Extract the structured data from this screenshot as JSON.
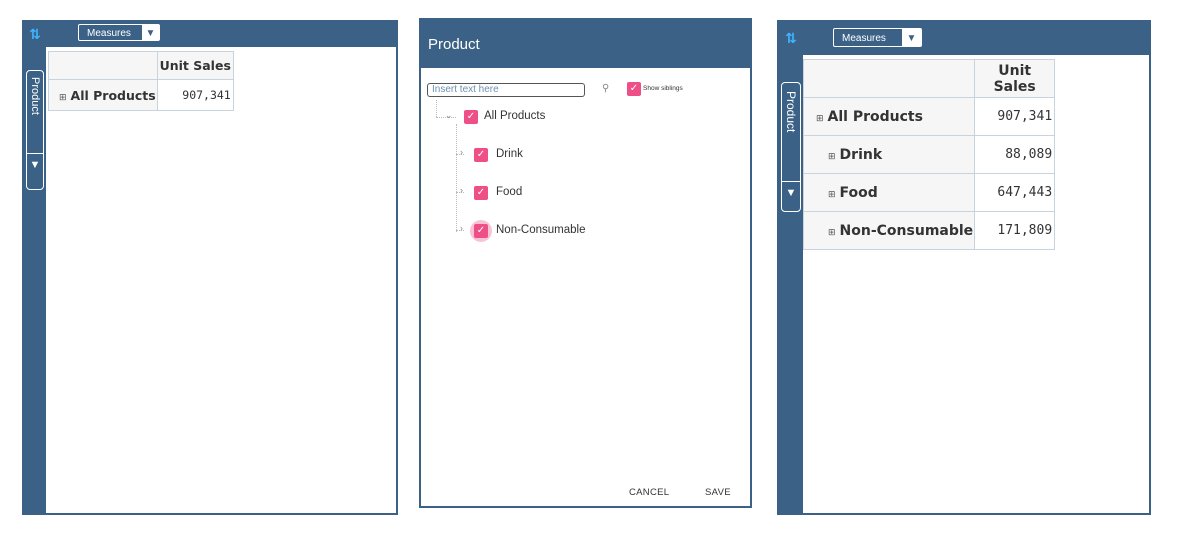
{
  "left_pivot": {
    "measures_label": "Measures",
    "side_tab_label": "Product",
    "header": "Unit Sales",
    "rows": [
      {
        "label": "All Products",
        "value": "907,341"
      }
    ]
  },
  "dialog": {
    "title": "Product",
    "search_placeholder": "Insert text here",
    "show_siblings_label": "Show siblings",
    "tree": [
      {
        "label": "All Products"
      },
      {
        "label": "Drink"
      },
      {
        "label": "Food"
      },
      {
        "label": "Non-Consumable"
      }
    ],
    "cancel_label": "CANCEL",
    "save_label": "SAVE"
  },
  "right_pivot": {
    "measures_label": "Measures",
    "side_tab_label": "Product",
    "header": "Unit Sales",
    "rows": [
      {
        "label": "All Products",
        "value": "907,341"
      },
      {
        "label": "Drink",
        "value": "88,089"
      },
      {
        "label": "Food",
        "value": "647,443"
      },
      {
        "label": "Non-Consumable",
        "value": "171,809"
      }
    ]
  },
  "colors": {
    "brand": "#3b6286",
    "checkbox": "#ee4f86",
    "corner_icon": "#3fb4ff"
  },
  "icons": [
    "swap-axes-icon",
    "filter-icon",
    "search-icon",
    "check-icon",
    "chevron-right-icon",
    "chevron-down-icon",
    "expand-plus-icon"
  ]
}
